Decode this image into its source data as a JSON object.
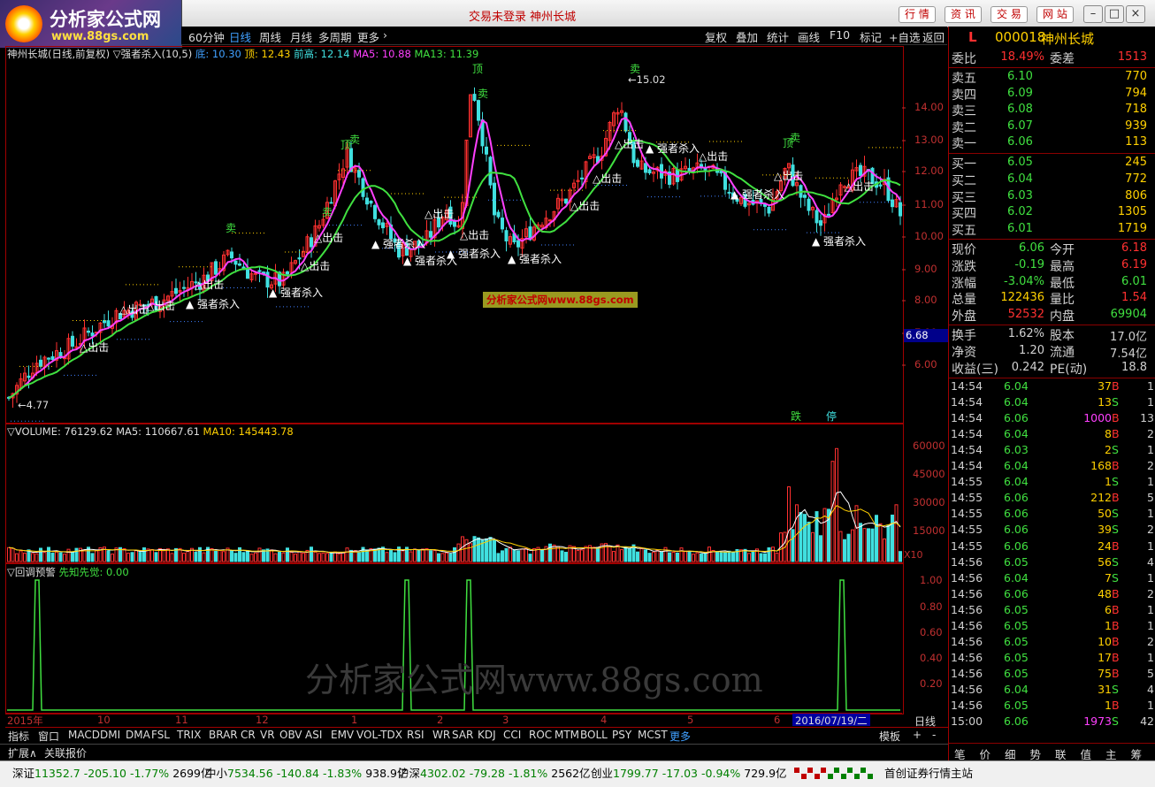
{
  "logo": {
    "name": "分析家公式网",
    "url": "www.88gs.com"
  },
  "titlebar": {
    "title": "交易未登录 神州长城",
    "buttons": [
      "行 情",
      "资 讯",
      "交 易",
      "网 站"
    ]
  },
  "toolbar": {
    "left": [
      "60分钟",
      "日线",
      "周线",
      "月线",
      "多周期",
      "更多"
    ],
    "right": [
      "复权",
      "叠加",
      "统计",
      "画线",
      "F10",
      "标记",
      "+自选",
      "返回"
    ]
  },
  "main_info": {
    "name": "神州长城(日线,前复权)",
    "indicator": "▽强者杀入(10,5)",
    "di": "底: 10.30",
    "ding": "顶: 12.43",
    "qiangao": "前高: 12.14",
    "ma5": "MA5: 10.88",
    "ma13": "MA13: 11.39"
  },
  "main_chart": {
    "y_ticks": [
      "14.00",
      "13.00",
      "12.00",
      "11.00",
      "10.00",
      "9.00",
      "8.00",
      "7.00",
      "6.00"
    ],
    "current_price_tag": "6.68",
    "annotations": {
      "high": "15.02",
      "low": "4.77"
    },
    "signals": [
      "强者杀入",
      "出击",
      "卖",
      "顶"
    ],
    "watermark_label": "分析家公式网www.88gs.com",
    "badges": [
      "跌",
      "停"
    ]
  },
  "volume_info": {
    "label": "▽VOLUME: 76129.62",
    "ma5": "MA5: 110667.61",
    "ma10": "MA10: 145443.78"
  },
  "volume_chart": {
    "y_ticks": [
      "60000",
      "45000",
      "30000",
      "15000"
    ],
    "unit": "X10"
  },
  "warn_info": {
    "label": "▽回调预警",
    "value": "先知先觉: 0.00"
  },
  "warn_chart": {
    "y_ticks": [
      "1.00",
      "0.80",
      "0.60",
      "0.40",
      "0.20"
    ]
  },
  "xaxis": {
    "labels": [
      "2015年",
      "10",
      "11",
      "12",
      "1",
      "2",
      "3",
      "4",
      "5",
      "6"
    ],
    "cursor_date": "2016/07/19/二",
    "period": "日线"
  },
  "big_watermark": "分析家公式网www.88gs.com",
  "tabs": [
    "指标",
    "窗口",
    "MACD",
    "DMI",
    "DMA",
    "FSL",
    "TRIX",
    "BRAR",
    "CR",
    "VR",
    "OBV",
    "ASI",
    "EMV",
    "VOL-TDX",
    "RSI",
    "WR",
    "SAR",
    "KDJ",
    "CCI",
    "ROC",
    "MTM",
    "BOLL",
    "PSY",
    "MCST",
    "更多"
  ],
  "tabs_right": [
    "模板",
    "+",
    "-"
  ],
  "subbar": [
    "扩展∧",
    "关联报价"
  ],
  "quote": {
    "market_flag": "L",
    "code": "000018",
    "name": "神州长城",
    "weibi": {
      "label": "委比",
      "value": "18.49%"
    },
    "weicha": {
      "label": "委差",
      "value": "1513"
    },
    "asks": [
      {
        "label": "卖五",
        "price": "6.10",
        "vol": "770"
      },
      {
        "label": "卖四",
        "price": "6.09",
        "vol": "794"
      },
      {
        "label": "卖三",
        "price": "6.08",
        "vol": "718"
      },
      {
        "label": "卖二",
        "price": "6.07",
        "vol": "939"
      },
      {
        "label": "卖一",
        "price": "6.06",
        "vol": "113"
      }
    ],
    "bids": [
      {
        "label": "买一",
        "price": "6.05",
        "vol": "245"
      },
      {
        "label": "买二",
        "price": "6.04",
        "vol": "772"
      },
      {
        "label": "买三",
        "price": "6.03",
        "vol": "806"
      },
      {
        "label": "买四",
        "price": "6.02",
        "vol": "1305"
      },
      {
        "label": "买五",
        "price": "6.01",
        "vol": "1719"
      }
    ],
    "stats": [
      {
        "l1": "现价",
        "v1": "6.06",
        "l2": "今开",
        "v2": "6.18"
      },
      {
        "l1": "涨跌",
        "v1": "-0.19",
        "l2": "最高",
        "v2": "6.19"
      },
      {
        "l1": "涨幅",
        "v1": "-3.04%",
        "l2": "最低",
        "v2": "6.01"
      },
      {
        "l1": "总量",
        "v1": "122436",
        "l2": "量比",
        "v2": "1.54"
      },
      {
        "l1": "外盘",
        "v1": "52532",
        "l2": "内盘",
        "v2": "69904"
      }
    ],
    "stats2": [
      {
        "l1": "换手",
        "v1": "1.62%",
        "l2": "股本",
        "v2": "17.0亿"
      },
      {
        "l1": "净资",
        "v1": "1.20",
        "l2": "流通",
        "v2": "7.54亿"
      },
      {
        "l1": "收益(三)",
        "v1": "0.242",
        "l2": "PE(动)",
        "v2": "18.8"
      }
    ],
    "ticks": [
      {
        "t": "14:54",
        "p": "6.04",
        "v": "37",
        "bs": "B",
        "n": "1"
      },
      {
        "t": "14:54",
        "p": "6.04",
        "v": "13",
        "bs": "S",
        "n": "1"
      },
      {
        "t": "14:54",
        "p": "6.06",
        "v": "1000",
        "bs": "B",
        "n": "13"
      },
      {
        "t": "14:54",
        "p": "6.04",
        "v": "8",
        "bs": "B",
        "n": "2"
      },
      {
        "t": "14:54",
        "p": "6.03",
        "v": "2",
        "bs": "S",
        "n": "1"
      },
      {
        "t": "14:54",
        "p": "6.04",
        "v": "168",
        "bs": "B",
        "n": "2"
      },
      {
        "t": "14:55",
        "p": "6.04",
        "v": "1",
        "bs": "S",
        "n": "1"
      },
      {
        "t": "14:55",
        "p": "6.06",
        "v": "212",
        "bs": "B",
        "n": "5"
      },
      {
        "t": "14:55",
        "p": "6.06",
        "v": "50",
        "bs": "S",
        "n": "1"
      },
      {
        "t": "14:55",
        "p": "6.06",
        "v": "39",
        "bs": "S",
        "n": "2"
      },
      {
        "t": "14:55",
        "p": "6.06",
        "v": "24",
        "bs": "B",
        "n": "1"
      },
      {
        "t": "14:56",
        "p": "6.05",
        "v": "56",
        "bs": "S",
        "n": "4"
      },
      {
        "t": "14:56",
        "p": "6.04",
        "v": "7",
        "bs": "S",
        "n": "1"
      },
      {
        "t": "14:56",
        "p": "6.06",
        "v": "48",
        "bs": "B",
        "n": "2"
      },
      {
        "t": "14:56",
        "p": "6.05",
        "v": "6",
        "bs": "B",
        "n": "1"
      },
      {
        "t": "14:56",
        "p": "6.05",
        "v": "1",
        "bs": "B",
        "n": "1"
      },
      {
        "t": "14:56",
        "p": "6.05",
        "v": "10",
        "bs": "B",
        "n": "2"
      },
      {
        "t": "14:56",
        "p": "6.05",
        "v": "17",
        "bs": "B",
        "n": "1"
      },
      {
        "t": "14:56",
        "p": "6.05",
        "v": "75",
        "bs": "B",
        "n": "5"
      },
      {
        "t": "14:56",
        "p": "6.04",
        "v": "31",
        "bs": "S",
        "n": "4"
      },
      {
        "t": "14:56",
        "p": "6.05",
        "v": "1",
        "bs": "B",
        "n": "1"
      },
      {
        "t": "15:00",
        "p": "6.06",
        "v": "1973",
        "bs": "S",
        "n": "42"
      }
    ],
    "bottom_tabs": [
      "笔",
      "价",
      "细",
      "势",
      "联",
      "值",
      "主",
      "筹"
    ]
  },
  "statusbar": [
    {
      "name": "深证",
      "val": "11352.7",
      "chg": "-205.10",
      "pct": "-1.77%",
      "amt": "2699亿"
    },
    {
      "name": "中小",
      "val": "7534.56",
      "chg": "-140.84",
      "pct": "-1.83%",
      "amt": "938.9亿"
    },
    {
      "name": "沪深",
      "val": "4302.02",
      "chg": "-79.28",
      "pct": "-1.81%",
      "amt": "2562亿"
    },
    {
      "name": "创业",
      "val": "1799.77",
      "chg": "-17.03",
      "pct": "-0.94%",
      "amt": "729.9亿"
    }
  ],
  "statusbar_right": "首创证券行情主站"
}
